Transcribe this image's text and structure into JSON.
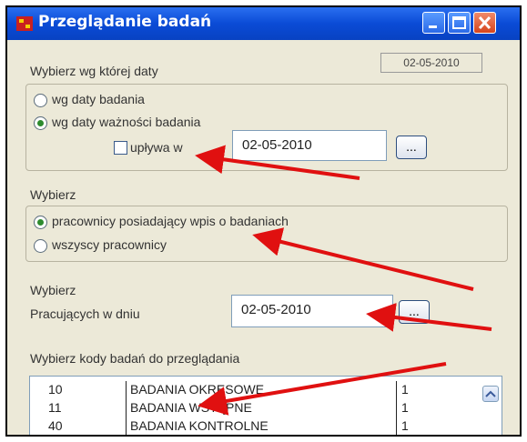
{
  "window": {
    "title": "Przeglądanie badań"
  },
  "header_date": "02-05-2010",
  "date_section": {
    "label": "Wybierz wg której daty",
    "options": [
      {
        "label": "wg daty badania",
        "selected": false
      },
      {
        "label": "wg daty ważności badania",
        "selected": true
      }
    ],
    "expires": {
      "label": "upływa w",
      "checked": false,
      "value": "02-05-2010",
      "button": "..."
    }
  },
  "employees_section": {
    "label": "Wybierz",
    "options": [
      {
        "label": "pracownicy posiadający wpis o badaniach",
        "selected": true
      },
      {
        "label": "wszyscy pracownicy",
        "selected": false
      }
    ]
  },
  "working_section": {
    "label": "Wybierz",
    "sublabel": "Pracujących w dniu",
    "value": "02-05-2010",
    "button": "..."
  },
  "codes_section": {
    "label": "Wybierz kody badań do przeglądania",
    "rows": [
      {
        "code": "10",
        "name": "BADANIA OKRESOWE",
        "value": "1"
      },
      {
        "code": "11",
        "name": "BADANIA WSTĘPNE",
        "value": "1"
      },
      {
        "code": "40",
        "name": "BADANIA KONTROLNE",
        "value": "1"
      }
    ]
  },
  "colors": {
    "titlebar": "#0a4bd6",
    "arrow": "#e01010",
    "panel": "#ece9d8"
  }
}
